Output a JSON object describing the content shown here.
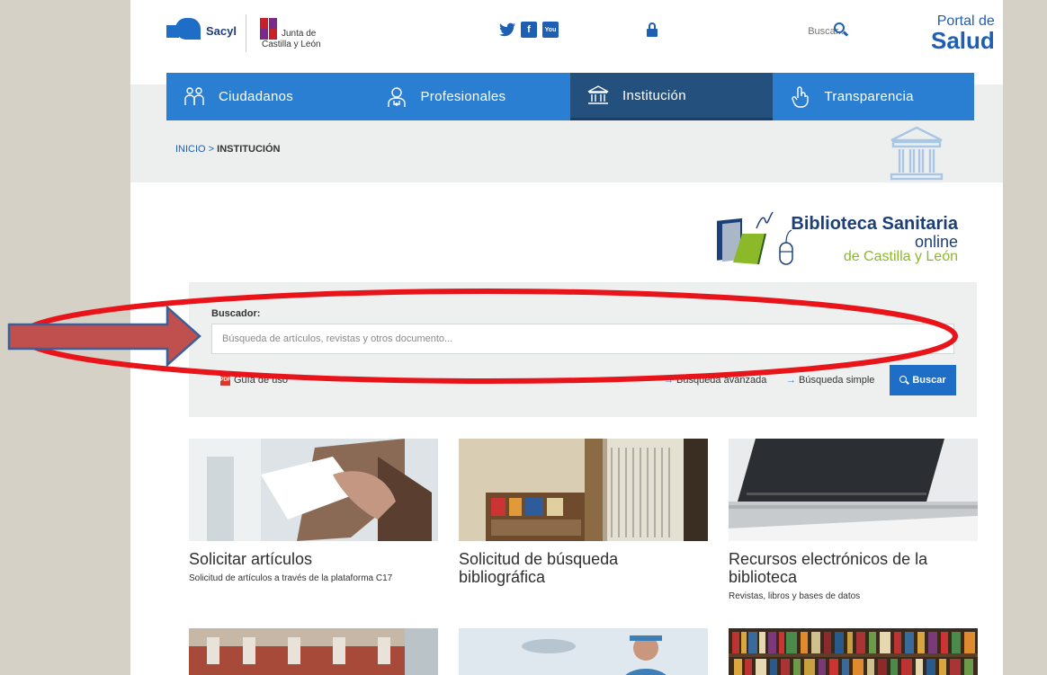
{
  "header": {
    "sacyl_label": "Sacyl",
    "junta_line1": "Junta de",
    "junta_line2": "Castilla y León",
    "social": [
      "twitter-icon",
      "facebook-icon",
      "youtube-icon"
    ],
    "facebook_glyph": "f",
    "youtube_glyph": "You",
    "search_placeholder": "Buscar...",
    "portal_line1": "Portal de",
    "portal_line2": "Salud"
  },
  "nav": {
    "items": [
      {
        "label": "Ciudadanos",
        "icon": "people-icon"
      },
      {
        "label": "Profesionales",
        "icon": "doctor-icon"
      },
      {
        "label": "Institución",
        "icon": "institution-icon",
        "active": true
      },
      {
        "label": "Transparencia",
        "icon": "hand-icon"
      }
    ]
  },
  "breadcrumb": {
    "home": "INICIO",
    "separator": " > ",
    "current": "INSTITUCIÓN"
  },
  "biblioteca": {
    "title": "Biblioteca Sanitaria",
    "subtitle": "online",
    "region": "de Castilla y León"
  },
  "search": {
    "label": "Buscador:",
    "placeholder": "Búsqueda de artículos, revistas y otros documento...",
    "guide_link": "Guía de uso",
    "advanced_link": "Búsqueda avanzada",
    "simple_link": "Búsqueda simple",
    "button_label": "Buscar"
  },
  "cards": [
    {
      "title": "Solicitar artículos",
      "desc": "Solicitud de artículos a través de la plataforma C17"
    },
    {
      "title": "Solicitud de búsqueda bibliográfica",
      "desc": ""
    },
    {
      "title": "Recursos electrónicos de la biblioteca",
      "desc": "Revistas, libros y bases de datos"
    }
  ],
  "colors": {
    "primary": "#2b7fd2",
    "nav_active": "#24507e",
    "brand_green": "#8cb92a",
    "annotation_red": "#e8141a",
    "arrow_fill": "#c0504d",
    "arrow_stroke": "#3a5f99"
  }
}
